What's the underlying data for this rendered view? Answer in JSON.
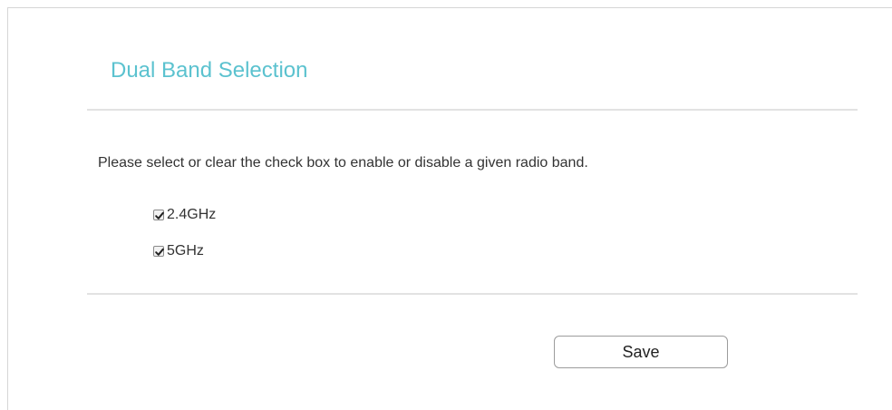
{
  "section": {
    "title": "Dual Band Selection",
    "description": "Please select or clear the check box to enable or disable a given radio band.",
    "title_color": "#5bc2cf"
  },
  "bands": [
    {
      "label": "2.4GHz",
      "checked": true,
      "icon": "checkmark-icon"
    },
    {
      "label": "5GHz",
      "checked": true,
      "icon": "checkmark-icon"
    }
  ],
  "actions": {
    "save_label": "Save"
  }
}
